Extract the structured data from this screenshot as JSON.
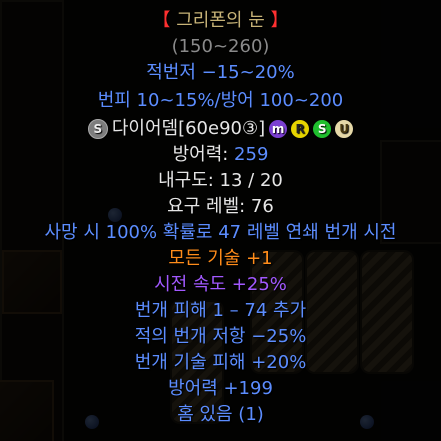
{
  "item": {
    "name_left": "【 ",
    "name": "그리폰의 눈",
    "name_right": " 】",
    "value_range": "(150~260)",
    "lines": {
      "fcr": "적번저 −15~20%",
      "fhr_def": "번피 10~15%/방어 100~200",
      "runeword": "다이어뎀[60e90③]",
      "defense_label": "방어력: ",
      "defense_value": "259",
      "durability": "내구도: 13 / 20",
      "req_level": "요구 레벨: 76",
      "chance_cast": "사망 시 100% 확률로 47 레벨 연쇄 번개 시전",
      "all_skills": "모든 기술 +1",
      "cast_speed": "시전 속도 +25%",
      "lightning_dmg": "번개 피해 1 – 74 추가",
      "enemy_res": "적의 번개 저항 −25%",
      "skill_dmg": "번개 기술 피해 +20%",
      "defense_bonus": "방어력 +199",
      "sockets": "홈 있음 (1)"
    },
    "socket_icons": {
      "left": "S",
      "tags": [
        "m",
        "R",
        "S",
        "U"
      ]
    }
  },
  "colors": {
    "unique_gold": "#c7b377",
    "magic_blue": "#5c8dff",
    "set_orange": "#ff8c1a",
    "purple": "#a259ff",
    "bracket_red": "#ff3030"
  }
}
